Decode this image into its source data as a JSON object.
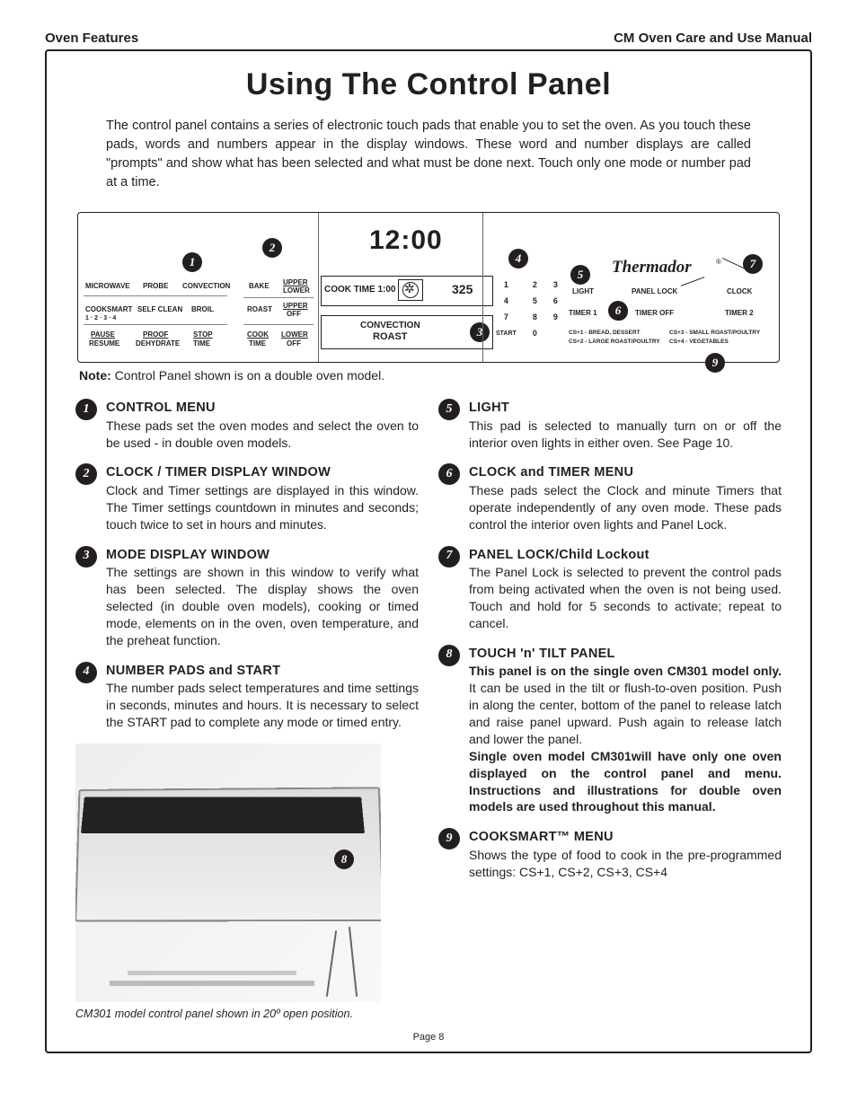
{
  "header": {
    "left": "Oven Features",
    "right": "CM Oven Care and Use Manual"
  },
  "title": "Using The Control Panel",
  "intro": "The control panel contains a series of electronic touch pads that enable you to set the oven.  As you touch these pads, words and numbers appear in the display windows.  These word and number displays are called \"prompts\" and show what has been selected and what must be done next. Touch only one mode or number pad at a time.",
  "panel": {
    "sec1": {
      "r1": [
        "MICROWAVE",
        "PROBE",
        "CONVECTION"
      ],
      "r2": [
        "COOKSMART",
        "SELF CLEAN",
        "BROIL"
      ],
      "r2b": "1 · 2 · 3 · 4",
      "r3": [
        "PAUSE",
        "PROOF",
        "STOP"
      ],
      "r3b": [
        "RESUME",
        "DEHYDRATE",
        "TIME"
      ]
    },
    "sec2": {
      "r1": [
        "BAKE",
        "UPPER"
      ],
      "r1b": "LOWER",
      "r2": [
        "ROAST",
        "UPPER"
      ],
      "r2b": "OFF",
      "r3": [
        "COOK",
        "LOWER"
      ],
      "r3b": [
        "TIME",
        "OFF"
      ]
    },
    "sec3": {
      "clock": "12:00",
      "cook": "COOK TIME 1:00",
      "temp": "325",
      "mode1": "CONVECTION",
      "mode2": "ROAST"
    },
    "sec4": {
      "nums": [
        [
          "1",
          "2",
          "3"
        ],
        [
          "4",
          "5",
          "6"
        ],
        [
          "7",
          "8",
          "9"
        ],
        [
          "START",
          "0",
          ""
        ]
      ]
    },
    "sec5": {
      "brand": "Thermador",
      "reg": "®",
      "row1": [
        "LIGHT",
        "PANEL LOCK",
        "CLOCK"
      ],
      "row2": [
        "TIMER 1",
        "TIMER OFF",
        "TIMER 2"
      ],
      "cs": [
        "CS+1 - BREAD, DESSERT",
        "CS+3 - SMALL ROAST/POULTRY",
        "CS+2 - LARGE ROAST/POULTRY",
        "CS+4 - VEGETABLES"
      ]
    }
  },
  "note": {
    "label": "Note:",
    "text": " Control Panel shown is on a double oven model."
  },
  "left_items": [
    {
      "n": "1",
      "title": "CONTROL MENU",
      "body": "These pads set the oven modes and select the oven to be used - in double oven models."
    },
    {
      "n": "2",
      "title": "CLOCK / TIMER DISPLAY WINDOW",
      "body": "Clock and Timer settings are displayed in this window.  The Timer settings countdown in minutes and seconds; touch twice to set in hours and minutes."
    },
    {
      "n": "3",
      "title": "MODE DISPLAY WINDOW",
      "body": "The settings are shown in this window to verify what has been selected. The display shows the oven selected (in double oven models), cooking or timed mode, elements on in the oven, oven temperature, and the preheat function."
    },
    {
      "n": "4",
      "title": "NUMBER PADS and START",
      "body": "The number pads select temperatures and time settings in seconds, minutes and hours. It is necessary to select the START pad to complete any mode or timed entry."
    }
  ],
  "right_items": [
    {
      "n": "5",
      "title": "LIGHT",
      "body": "This pad is selected to manually turn on or off the interior oven lights in either oven.  See Page 10."
    },
    {
      "n": "6",
      "title": "CLOCK and TIMER MENU",
      "body": "These pads select the Clock and minute Timers that operate independently of any oven mode. These pads control the interior oven lights and Panel Lock."
    },
    {
      "n": "7",
      "title": "PANEL LOCK/Child Lockout",
      "body": "The Panel Lock is selected to prevent the control pads from being activated when the oven is not being used.  Touch and hold for 5 seconds to activate; repeat to cancel."
    },
    {
      "n": "8",
      "title": "TOUCH 'n' TILT PANEL",
      "body_html": "<b>This panel is on the single oven CM301 model only.</b> It can be used in the tilt or flush-to-oven position. Push in along the center, bottom of the panel to release latch and raise panel upward. Push again to release latch and lower the panel.<br><b>Single oven model CM301will have only one oven displayed on the control panel and menu.  Instructions and illustrations for double oven models are used throughout this manual.</b>"
    },
    {
      "n": "9",
      "title": "COOKSMART™ MENU",
      "body": "Shows the type of food to cook in the pre-programmed settings:  CS+1, CS+2, CS+3, CS+4"
    }
  ],
  "caption": "CM301 model control panel shown in 20º open position.",
  "footer": "Page 8"
}
